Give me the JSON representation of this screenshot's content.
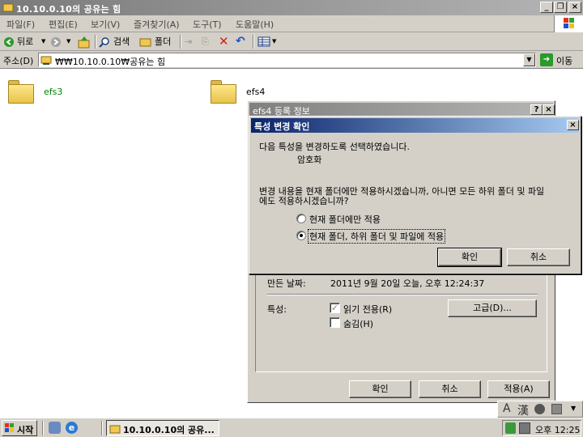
{
  "window": {
    "title": "10.10.0.10의 공유는 힘",
    "menu": [
      "파일(F)",
      "편집(E)",
      "보기(V)",
      "즐겨찾기(A)",
      "도구(T)",
      "도움말(H)"
    ]
  },
  "toolbar": {
    "back": "뒤로",
    "search": "검색",
    "folders": "폴더"
  },
  "address": {
    "label": "주소(D)",
    "value": "₩₩10.10.0.10₩공유는 힘",
    "go": "이동"
  },
  "folders": [
    {
      "name": "efs3"
    },
    {
      "name": "efs4"
    }
  ],
  "properties": {
    "title": "efs4 등록 정보",
    "created_label": "만든 날짜:",
    "created_value": "2011년 9월 20일 오늘, 오후 12:24:37",
    "attributes_label": "특성:",
    "readonly": "읽기 전용(R)",
    "hidden": "숨김(H)",
    "advanced": "고급(D)...",
    "ok": "확인",
    "cancel": "취소",
    "apply": "적용(A)"
  },
  "confirm": {
    "title": "특성 변경 확인",
    "line1": "다음 특성을 변경하도록 선택하였습니다.",
    "attr": "암호화",
    "question_line1": "변경 내용을 현재 폴더에만 적용하시겠습니까, 아니면 모든 하위 폴더 및 파일",
    "question_line2": "에도 적용하시겠습니까?",
    "option1": "현재 폴더에만 적용",
    "option2": "현재 폴더, 하위 폴더 및 파일에 적용",
    "selected_option": 2,
    "ok": "확인",
    "cancel": "취소"
  },
  "taskbar": {
    "start": "시작",
    "task": "10.10.0.10의 공유...",
    "clock": "오후 12:25"
  },
  "langbar": {
    "mode": "A",
    "hanja": "漢"
  },
  "colors": {
    "active_title": "#0a246a",
    "inactive_title": "#808080",
    "folder_label": "#008000"
  }
}
